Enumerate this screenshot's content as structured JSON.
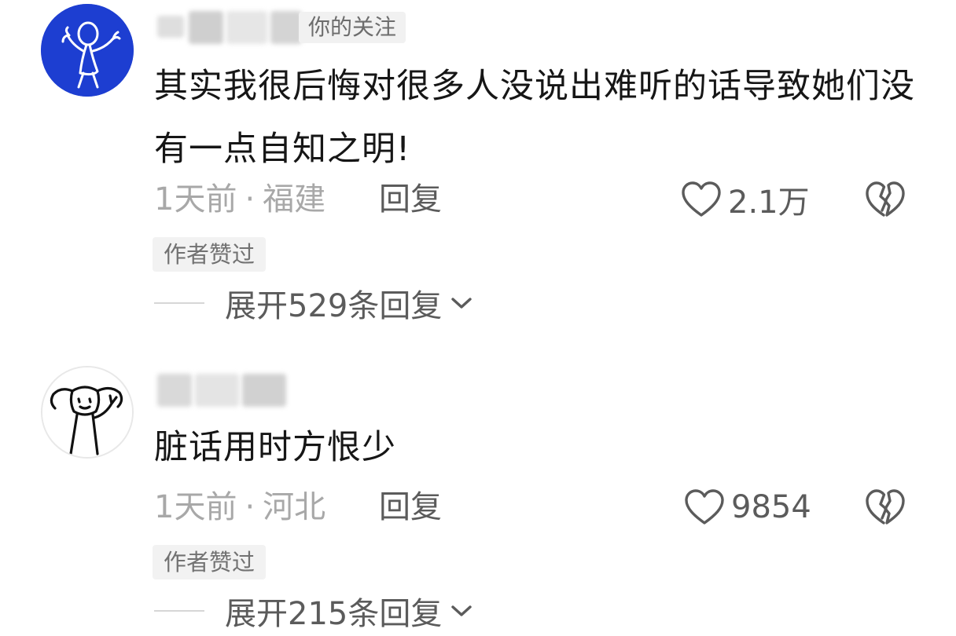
{
  "comments": [
    {
      "follow_tag": "你的关注",
      "text": "其实我很后悔对很多人没说出难听的话导致她们没有一点自知之明!",
      "time": "1天前",
      "separator": "·",
      "location": "福建",
      "reply_label": "回复",
      "like_count": "2.1万",
      "author_liked_label": "作者赞过",
      "expand_label": "展开529条回复",
      "avatar_icon": "blue-stick-figure-avatar",
      "avatar_bg": "#1d3ed1"
    },
    {
      "text": "脏话用时方恨少",
      "time": "1天前",
      "separator": "·",
      "location": "河北",
      "reply_label": "回复",
      "like_count": "9854",
      "author_liked_label": "作者赞过",
      "expand_label": "展开215条回复",
      "avatar_icon": "doodle-girl-avatar",
      "avatar_bg": "#ffffff"
    }
  ],
  "colors": {
    "primary_text": "#161616",
    "meta_text": "#a8a8a8",
    "action_text": "#5b5b5b",
    "tag_bg": "#f2f2f2"
  }
}
